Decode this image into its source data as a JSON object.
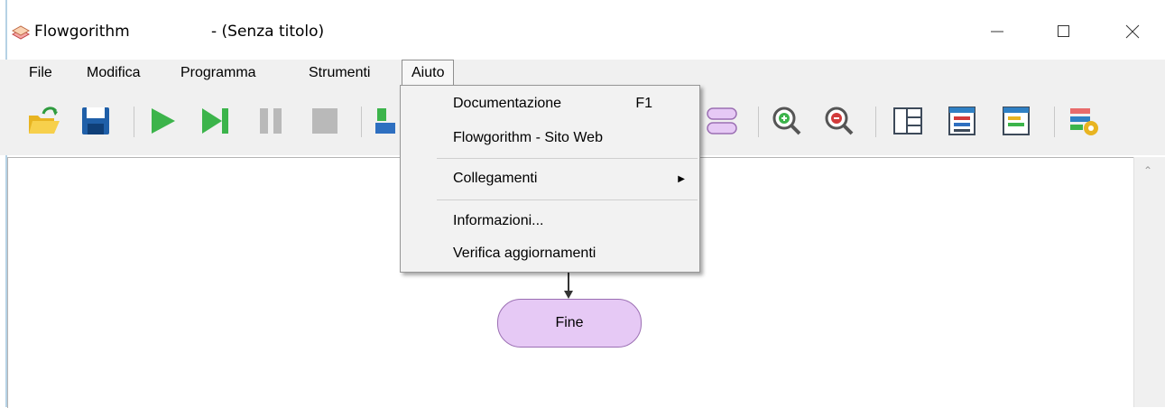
{
  "window": {
    "app_name": "Flowgorithm",
    "doc_title": "- (Senza titolo)",
    "controls": {
      "minimize_icon": "minimize-icon",
      "maximize_icon": "maximize-icon",
      "close_icon": "close-icon"
    }
  },
  "menubar": {
    "items": [
      {
        "label": "File"
      },
      {
        "label": "Modifica"
      },
      {
        "label": "Programma"
      },
      {
        "label": "Strumenti"
      },
      {
        "label": "Aiuto",
        "active": true
      }
    ]
  },
  "toolbar": {
    "buttons": [
      {
        "icon": "open-folder-icon"
      },
      {
        "icon": "save-icon"
      },
      {
        "icon": "run-icon"
      },
      {
        "icon": "step-icon"
      },
      {
        "icon": "pause-icon"
      },
      {
        "icon": "stop-icon"
      },
      {
        "icon": "add-function-icon"
      },
      {
        "icon": "flowchart-shape-icon"
      },
      {
        "icon": "zoom-in-icon"
      },
      {
        "icon": "zoom-out-icon"
      },
      {
        "icon": "layout-panels-icon"
      },
      {
        "icon": "variable-watch-icon"
      },
      {
        "icon": "console-icon"
      },
      {
        "icon": "settings-layout-icon"
      }
    ]
  },
  "help_menu": {
    "documentation": "Documentazione",
    "documentation_shortcut": "F1",
    "website": "Flowgorithm - Sito Web",
    "links": "Collegamenti",
    "info": "Informazioni...",
    "check_updates": "Verifica aggiornamenti"
  },
  "flowchart": {
    "end_node": "Fine"
  },
  "colors": {
    "menubar_bg": "#f0f0f0",
    "end_node_fill": "#e6c9f5",
    "end_node_border": "#9b6fb3",
    "play_green": "#3cb44b",
    "save_blue": "#1f5fa8",
    "folder_yellow": "#f2c12e"
  }
}
